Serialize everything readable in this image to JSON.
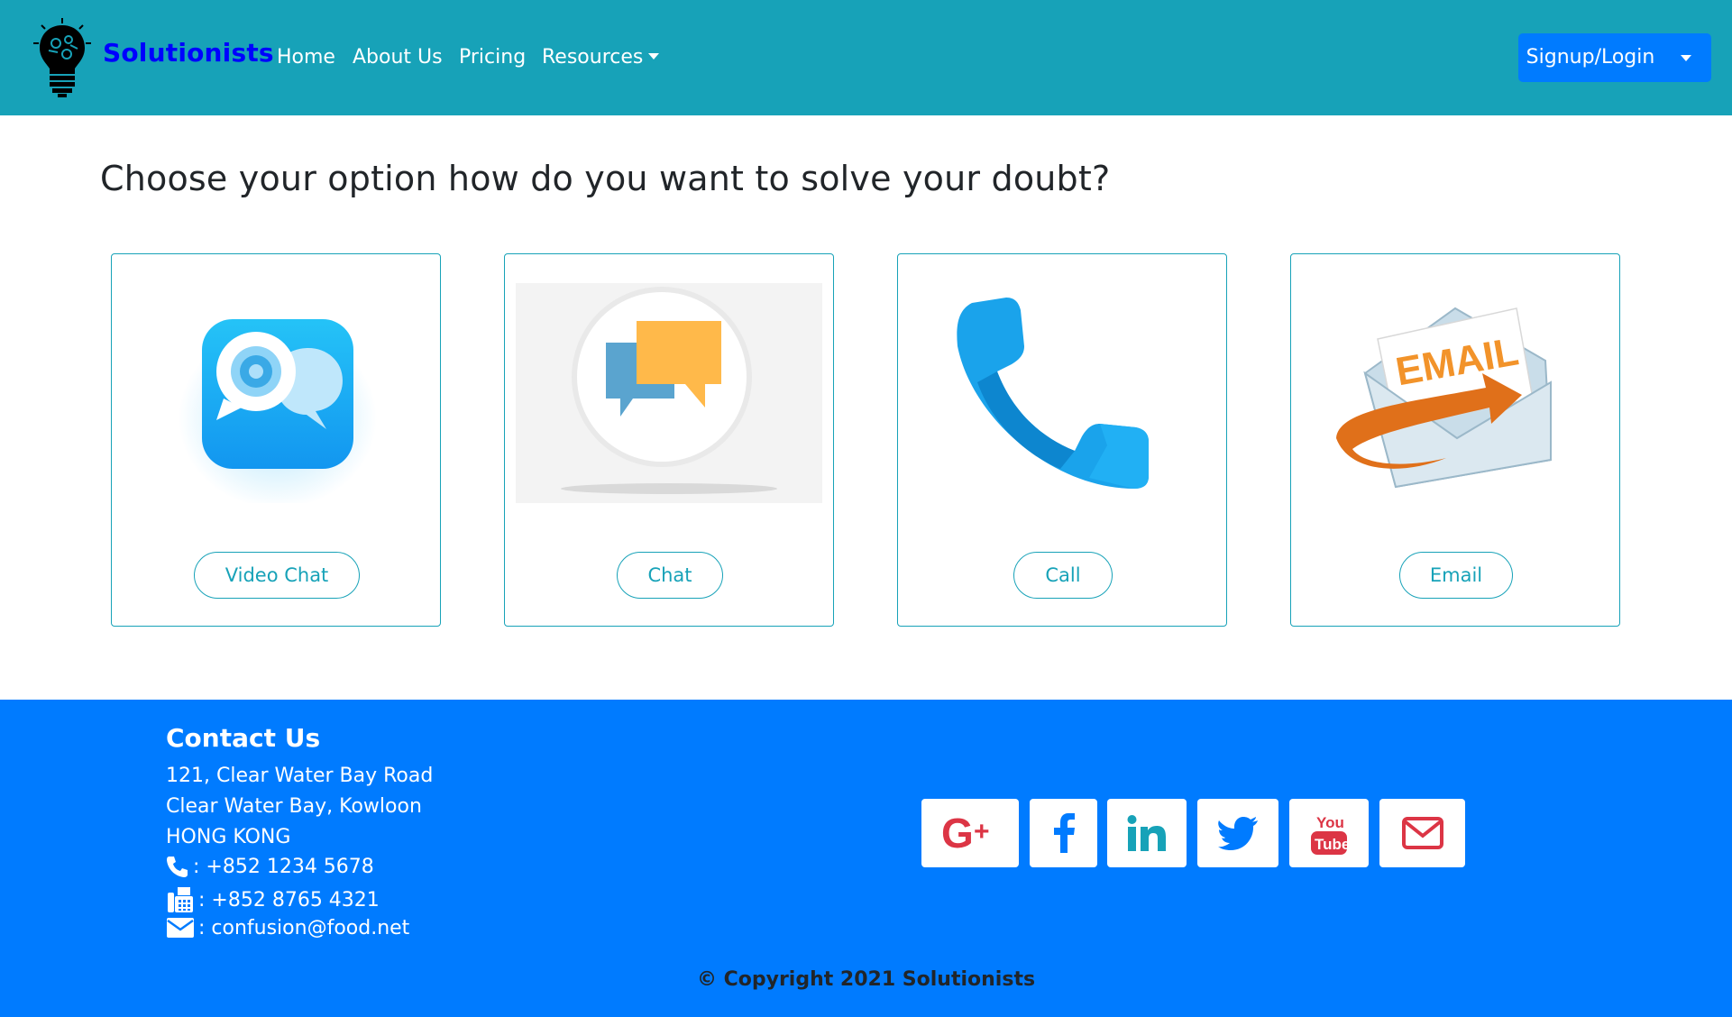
{
  "navbar": {
    "brand": "Solutionists",
    "links": [
      "Home",
      "About Us",
      "Pricing",
      "Resources"
    ],
    "signup_label": "Signup/Login"
  },
  "main": {
    "heading": "Choose your option how do you want to solve your doubt?",
    "options": [
      {
        "label": "Video Chat",
        "icon": "video-chat-icon"
      },
      {
        "label": "Chat",
        "icon": "chat-bubbles-icon"
      },
      {
        "label": "Call",
        "icon": "phone-icon"
      },
      {
        "label": "Email",
        "icon": "email-envelope-icon"
      }
    ]
  },
  "footer": {
    "contact_title": "Contact Us",
    "address": [
      "121, Clear Water Bay Road",
      "Clear Water Bay, Kowloon",
      "HONG KONG"
    ],
    "phone": ": +852 1234 5678",
    "fax": ": +852 8765 4321",
    "email": ": confusion@food.net",
    "social": [
      "google-plus-icon",
      "facebook-icon",
      "linkedin-icon",
      "twitter-icon",
      "youtube-icon",
      "mail-icon"
    ],
    "copyright": "© Copyright 2021 Solutionists"
  },
  "colors": {
    "navbar": "#17a2b8",
    "brand": "#0000ff",
    "primary": "#007bff",
    "accent": "#17a2b8"
  }
}
